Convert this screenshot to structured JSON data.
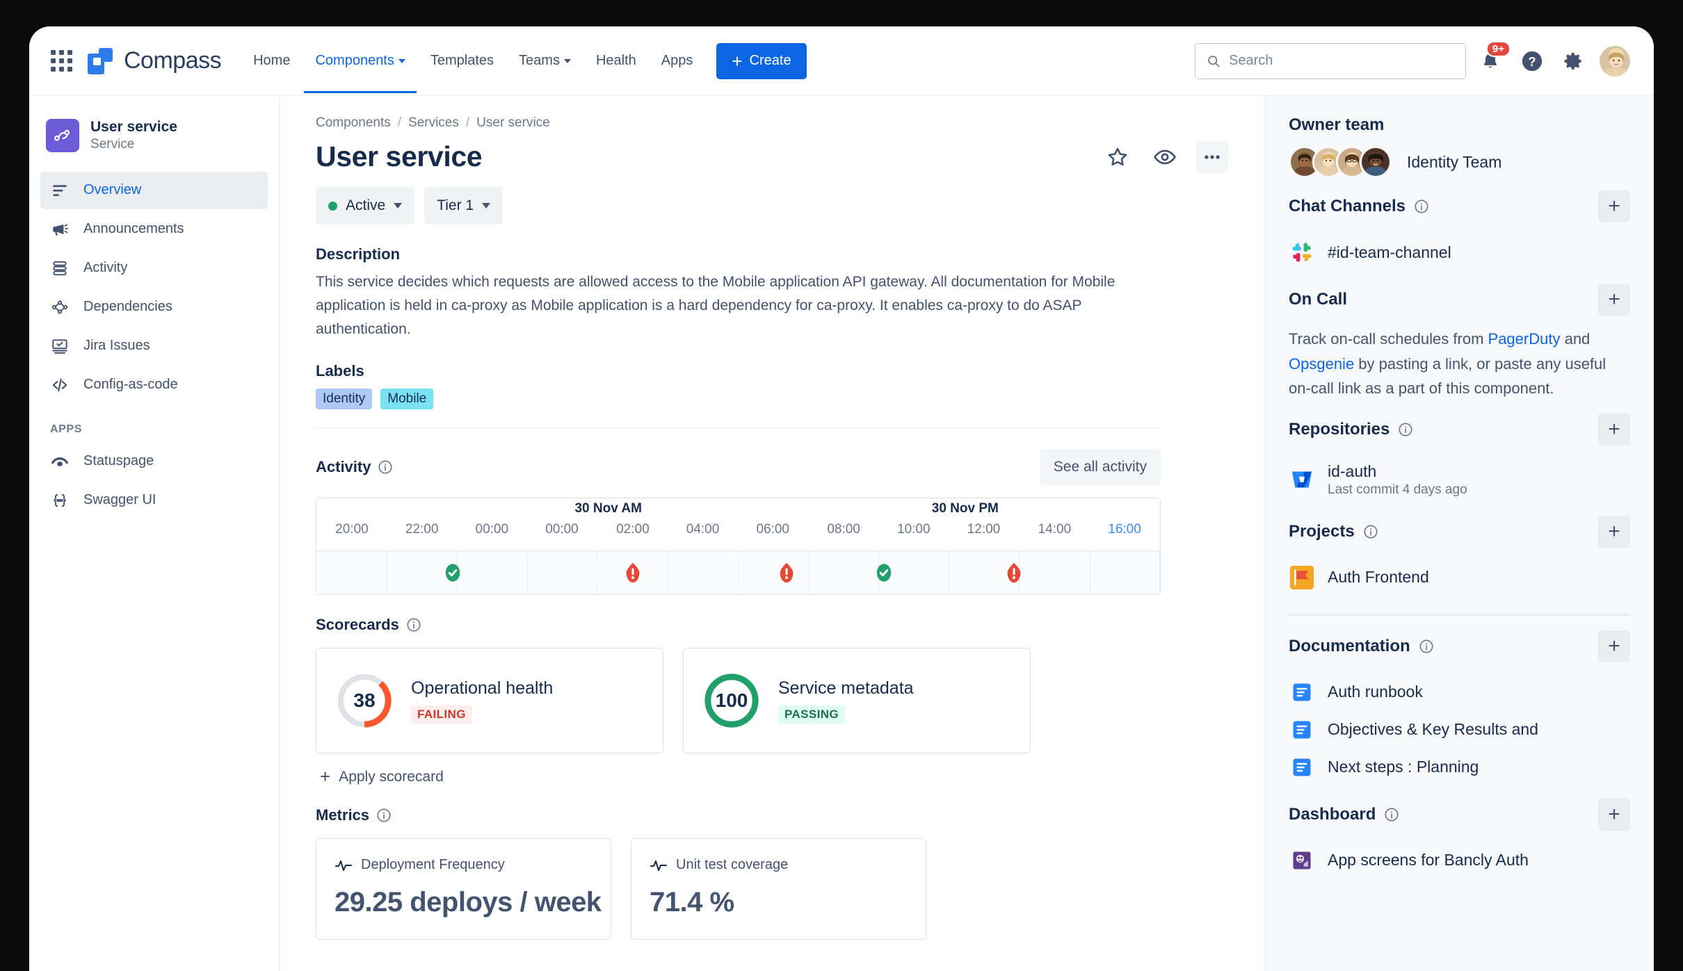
{
  "topnav": {
    "app_switcher": "app-switcher",
    "brand": "Compass",
    "links": [
      {
        "label": "Home",
        "dropdown": false,
        "active": false
      },
      {
        "label": "Components",
        "dropdown": true,
        "active": true
      },
      {
        "label": "Templates",
        "dropdown": false,
        "active": false
      },
      {
        "label": "Teams",
        "dropdown": true,
        "active": false
      },
      {
        "label": "Health",
        "dropdown": false,
        "active": false
      },
      {
        "label": "Apps",
        "dropdown": false,
        "active": false
      }
    ],
    "create_label": "Create",
    "search_placeholder": "Search",
    "search_value": "",
    "notification_badge": "9+"
  },
  "sidebar": {
    "component_name": "User service",
    "component_type": "Service",
    "items": [
      {
        "label": "Overview",
        "icon": "overview-icon",
        "active": true
      },
      {
        "label": "Announcements",
        "icon": "megaphone-icon",
        "active": false
      },
      {
        "label": "Activity",
        "icon": "activity-icon",
        "active": false
      },
      {
        "label": "Dependencies",
        "icon": "dependencies-icon",
        "active": false
      },
      {
        "label": "Jira Issues",
        "icon": "jira-issues-icon",
        "active": false
      },
      {
        "label": "Config-as-code",
        "icon": "code-icon",
        "active": false
      }
    ],
    "apps_heading": "APPS",
    "apps": [
      {
        "label": "Statuspage",
        "icon": "statuspage-icon"
      },
      {
        "label": "Swagger UI",
        "icon": "swagger-icon"
      }
    ]
  },
  "main": {
    "breadcrumbs": [
      "Components",
      "Services",
      "User service"
    ],
    "title": "User service",
    "status_pill": "Active",
    "tier_pill": "Tier 1",
    "description_heading": "Description",
    "description": "This service decides which requests are allowed access to the Mobile application API gateway. All documentation for Mobile application is held in ca-proxy as Mobile application is a hard dependency for ca-proxy. It enables ca-proxy to do ASAP authentication.",
    "labels_heading": "Labels",
    "labels": [
      "Identity",
      "Mobile"
    ],
    "activity_heading": "Activity",
    "see_all_activity": "See all activity",
    "scorecards_heading": "Scorecards",
    "apply_scorecard": "Apply scorecard",
    "metrics_heading": "Metrics",
    "scorecards": [
      {
        "score": "38",
        "name": "Operational health",
        "status": "FAILING",
        "state": "failing",
        "percent": 38
      },
      {
        "score": "100",
        "name": "Service metadata",
        "status": "PASSING",
        "state": "passing",
        "percent": 100
      }
    ],
    "metrics": [
      {
        "name": "Deployment Frequency",
        "value": "29.25 deploys / week"
      },
      {
        "name": "Unit test coverage",
        "value": "71.4 %"
      }
    ]
  },
  "chart_data": {
    "type": "timeline",
    "title": "Activity",
    "day_labels": [
      {
        "text": "30 Nov AM",
        "position_pct": 34.6
      },
      {
        "text": "30 Nov PM",
        "position_pct": 76.9
      }
    ],
    "tick_labels": [
      "20:00",
      "22:00",
      "00:00",
      "00:00",
      "02:00",
      "04:00",
      "06:00",
      "08:00",
      "10:00",
      "12:00",
      "14:00",
      "16:00"
    ],
    "tick_positions_pct": [
      4.2,
      12.5,
      20.8,
      29.1,
      37.5,
      45.8,
      54.1,
      62.5,
      70.8,
      79.1,
      87.5,
      95.8
    ],
    "current_tick": "16:00",
    "column_positions_pct": [
      4.2,
      12.5,
      20.8,
      29.1,
      37.5,
      45.8,
      54.1,
      62.5,
      70.8,
      79.1,
      87.5,
      95.8
    ],
    "events": [
      {
        "type": "success",
        "position_pct": 12.0
      },
      {
        "type": "error",
        "position_pct": 33.4
      },
      {
        "type": "error",
        "position_pct": 51.6
      },
      {
        "type": "success",
        "position_pct": 63.1
      },
      {
        "type": "error",
        "position_pct": 78.5
      }
    ],
    "xlabel": "",
    "ylabel": "",
    "grid": true
  },
  "right": {
    "owner_team_heading": "Owner team",
    "owner_team_name": "Identity Team",
    "chat_heading": "Chat Channels",
    "chat_items": [
      {
        "label": "#id-team-channel",
        "icon": "slack-icon"
      }
    ],
    "oncall_heading": "On Call",
    "oncall_text_1": "Track on-call schedules from ",
    "oncall_link_1": "PagerDuty",
    "oncall_text_2": " and ",
    "oncall_link_2": "Opsgenie",
    "oncall_text_3": " by pasting a link, or paste any useful on-call link as a part of this component.",
    "repos_heading": "Repositories",
    "repos": [
      {
        "label": "id-auth",
        "sub": "Last commit 4 days ago",
        "icon": "bitbucket-icon"
      }
    ],
    "projects_heading": "Projects",
    "projects": [
      {
        "label": "Auth Frontend",
        "icon": "jira-project-icon"
      }
    ],
    "docs_heading": "Documentation",
    "docs": [
      {
        "label": "Auth runbook",
        "icon": "confluence-doc-icon"
      },
      {
        "label": "Objectives & Key Results and",
        "icon": "confluence-doc-icon"
      },
      {
        "label": "Next steps : Planning",
        "icon": "confluence-doc-icon"
      }
    ],
    "dashboard_heading": "Dashboard",
    "dashboards": [
      {
        "label": "App screens for Bancly Auth",
        "icon": "dashboard-icon"
      }
    ],
    "add_label": "+"
  },
  "colors": {
    "brand_blue": "#2e7ceb",
    "link_blue": "#0c66e4",
    "success_green": "#22a06b",
    "error_red": "#e34935",
    "failing_red": "#ff5630",
    "text_dark": "#172b4d",
    "text_muted": "#6b778c",
    "panel_bg": "#f7f8f9"
  }
}
